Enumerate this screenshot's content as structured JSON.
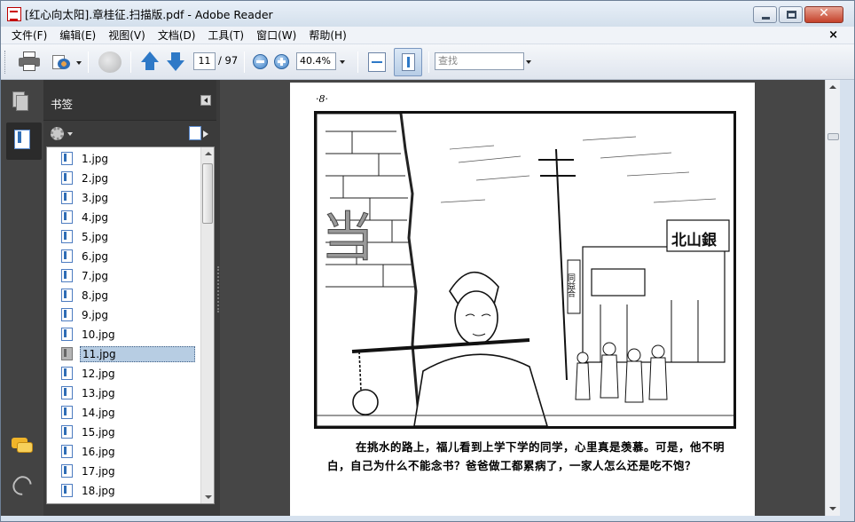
{
  "window": {
    "title": "[红心向太阳].章桂征.扫描版.pdf - Adobe Reader"
  },
  "menu": {
    "items": [
      "文件(F)",
      "编辑(E)",
      "视图(V)",
      "文档(D)",
      "工具(T)",
      "窗口(W)",
      "帮助(H)"
    ],
    "close_doc": "×"
  },
  "toolbar": {
    "current_page": "11",
    "total_pages": "/ 97",
    "zoom": "40.4%",
    "search_placeholder": "查找"
  },
  "bookmarks": {
    "title": "书签",
    "items": [
      "1.jpg",
      "2.jpg",
      "3.jpg",
      "4.jpg",
      "5.jpg",
      "6.jpg",
      "7.jpg",
      "8.jpg",
      "9.jpg",
      "10.jpg",
      "11.jpg",
      "12.jpg",
      "13.jpg",
      "14.jpg",
      "15.jpg",
      "16.jpg",
      "17.jpg",
      "18.jpg"
    ],
    "selected": "11.jpg"
  },
  "document": {
    "page_number": "·8·",
    "caption": "在挑水的路上，福儿看到上学下学的同学，心里真是羡慕。可是，他不明白，自己为什么不能念书？爸爸做工都累病了，一家人怎么还是吃不饱？",
    "sign_left": "当",
    "sign_right": "北山銀",
    "sign_pole": "同益合"
  },
  "colors": {
    "panel_dark": "#3b3b3b",
    "doc_bg": "#464646",
    "selection": "#b7cde3",
    "accent_blue": "#2e79c7"
  }
}
